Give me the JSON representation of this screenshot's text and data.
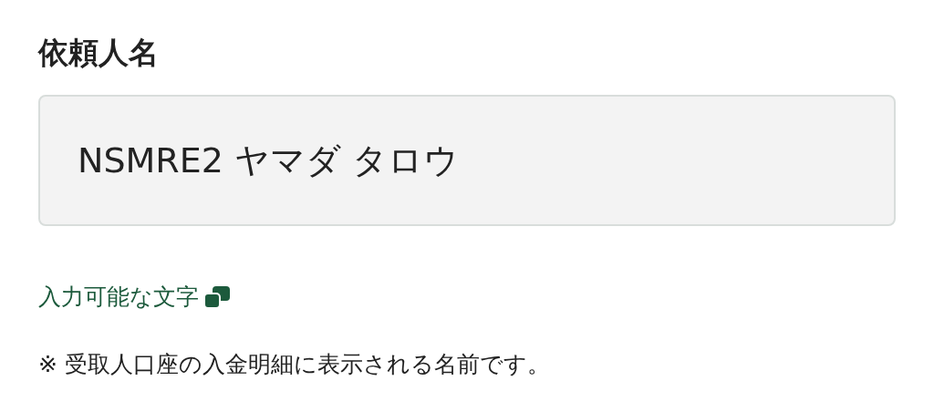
{
  "field": {
    "label": "依頼人名",
    "value": "NSMRE2 ヤマダ タロウ"
  },
  "link": {
    "text": "入力可能な文字"
  },
  "note": "※ 受取人口座の入金明細に表示される名前です。"
}
